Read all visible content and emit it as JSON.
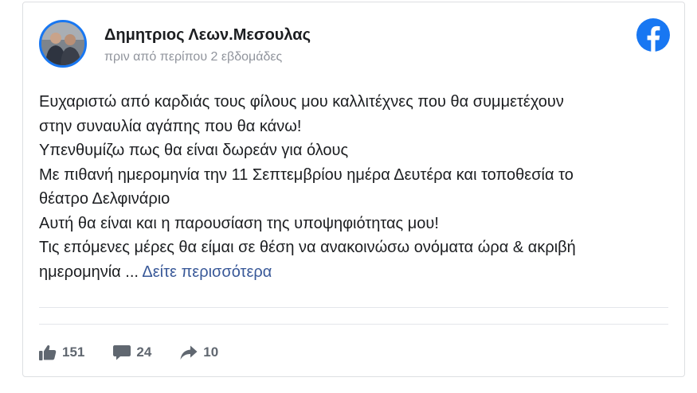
{
  "post": {
    "author": "Δημητριος Λεων.Μεσουλας",
    "timestamp": "πριν από περίπου 2 εβδομάδες",
    "lines": [
      "Ευχαριστώ από καρδιάς τους φίλους μου καλλιτέχνες που θα συμμετέχουν",
      "στην συναυλία αγάπης που θα κάνω!",
      "Υπενθυμίζω πως θα είναι δωρεάν για όλους",
      "Με πιθανή ημερομηνία την 11 Σεπτεμβρίου ημέρα Δευτέρα και τοποθεσία το",
      "θέατρο Δελφινάριο",
      "Αυτή θα είναι και η παρουσίαση της υποψηφιότητας μου!",
      "Τις επόμενες μέρες θα είμαι σε θέση να ανακοινώσω ονόματα ώρα & ακριβή"
    ],
    "last_line": "ημερομηνία ... ",
    "see_more": "Δείτε περισσότερα"
  },
  "stats": {
    "likes": "151",
    "comments": "24",
    "shares": "10"
  },
  "icons": {
    "brand": "facebook-logo-icon",
    "like": "thumbs-up-icon",
    "comment": "speech-bubble-icon",
    "share": "share-arrow-icon"
  },
  "colors": {
    "brand_blue": "#1877f2",
    "text": "#1c1e21",
    "muted": "#90949c",
    "link": "#385898",
    "stat_text": "#606770"
  }
}
